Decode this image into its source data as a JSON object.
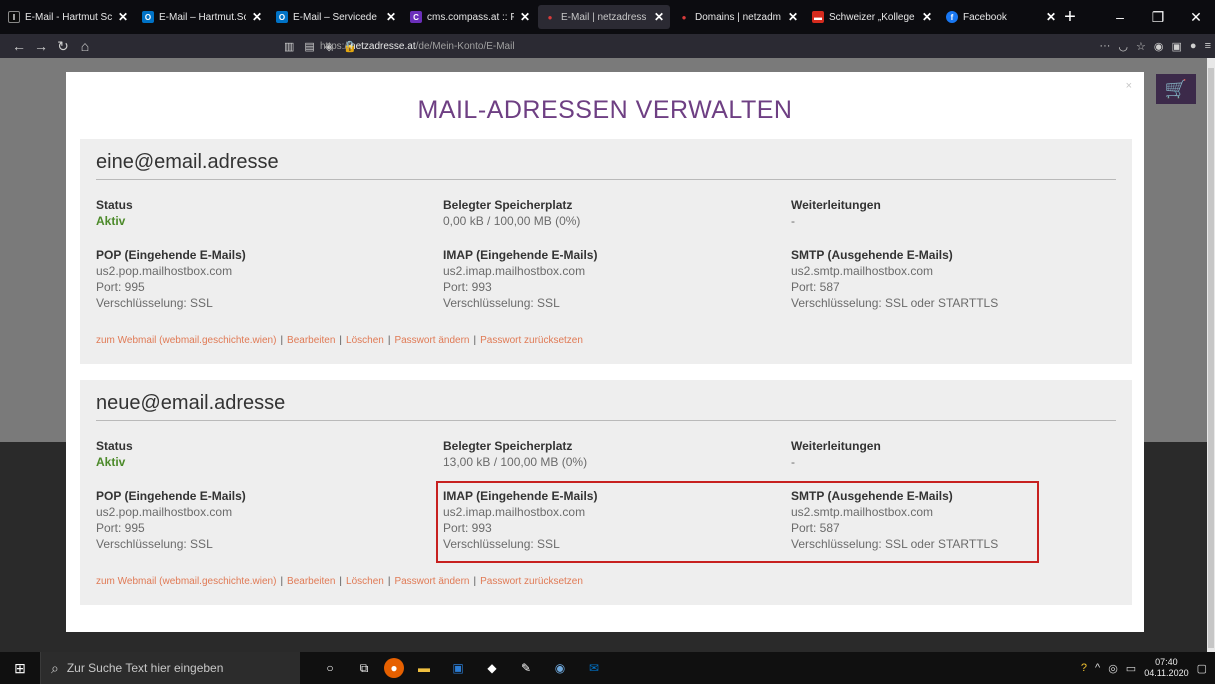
{
  "browser": {
    "tabs": [
      {
        "title": "E-Mail - Hartmut Sc",
        "favicon": "I",
        "color": "#0a0a0a",
        "active": false
      },
      {
        "title": "E-Mail – Hartmut.Sc",
        "favicon": "O",
        "color": "#0072c6",
        "active": false
      },
      {
        "title": "E-Mail – Servicede",
        "favicon": "O",
        "color": "#0072c6",
        "active": false
      },
      {
        "title": "cms.compass.at :: Pr",
        "favicon": "C",
        "color": "#6b2fba",
        "active": false
      },
      {
        "title": "E-Mail | netzadress",
        "favicon": "●",
        "color": "#d83b3b",
        "active": true
      },
      {
        "title": "Domains | netzadm",
        "favicon": "●",
        "color": "#d83b3b",
        "active": false
      },
      {
        "title": "Schweizer „Kollege",
        "favicon": "▬",
        "color": "#d52b1e",
        "active": false
      },
      {
        "title": "Facebook",
        "favicon": "f",
        "color": "#1877f2",
        "active": false
      }
    ],
    "url_prefix": "https://",
    "url_domain": "netzadresse.at",
    "url_path": "/de/Mein-Konto/E-Mail"
  },
  "modal": {
    "close": "×",
    "title": "MAIL-ADRESSEN VERWALTEN",
    "accounts": [
      {
        "email": "eine@email.adresse",
        "status_label": "Status",
        "status_value": "Aktiv",
        "storage_label": "Belegter Speicherplatz",
        "storage_value": "0,00 kB / 100,00 MB (0%)",
        "forward_label": "Weiterleitungen",
        "forward_value": "-",
        "pop": {
          "label": "POP (Eingehende E-Mails)",
          "host": "us2.pop.mailhostbox.com",
          "port": "Port: 995",
          "enc": "Verschlüsselung: SSL"
        },
        "imap": {
          "label": "IMAP (Eingehende E-Mails)",
          "host": "us2.imap.mailhostbox.com",
          "port": "Port: 993",
          "enc": "Verschlüsselung: SSL"
        },
        "smtp": {
          "label": "SMTP (Ausgehende E-Mails)",
          "host": "us2.smtp.mailhostbox.com",
          "port": "Port: 587",
          "enc": "Verschlüsselung: SSL oder STARTTLS"
        },
        "links": [
          "zum Webmail (webmail.geschichte.wien)",
          "Bearbeiten",
          "Löschen",
          "Passwort ändern",
          "Passwort zurücksetzen"
        ]
      },
      {
        "email": "neue@email.adresse",
        "status_label": "Status",
        "status_value": "Aktiv",
        "storage_label": "Belegter Speicherplatz",
        "storage_value": "13,00 kB / 100,00 MB (0%)",
        "forward_label": "Weiterleitungen",
        "forward_value": "-",
        "pop": {
          "label": "POP (Eingehende E-Mails)",
          "host": "us2.pop.mailhostbox.com",
          "port": "Port: 995",
          "enc": "Verschlüsselung: SSL"
        },
        "imap": {
          "label": "IMAP (Eingehende E-Mails)",
          "host": "us2.imap.mailhostbox.com",
          "port": "Port: 993",
          "enc": "Verschlüsselung: SSL"
        },
        "smtp": {
          "label": "SMTP (Ausgehende E-Mails)",
          "host": "us2.smtp.mailhostbox.com",
          "port": "Port: 587",
          "enc": "Verschlüsselung: SSL oder STARTTLS"
        },
        "links": [
          "zum Webmail (webmail.geschichte.wien)",
          "Bearbeiten",
          "Löschen",
          "Passwort ändern",
          "Passwort zurücksetzen"
        ]
      }
    ]
  },
  "taskbar": {
    "search_placeholder": "Zur Suche Text hier eingeben",
    "time": "07:40",
    "date": "04.11.2020"
  },
  "colors": {
    "title_purple": "#6e3f83",
    "status_green": "#4c8a2a",
    "link_orange": "#e07a55",
    "highlight_red": "#c7201f"
  }
}
